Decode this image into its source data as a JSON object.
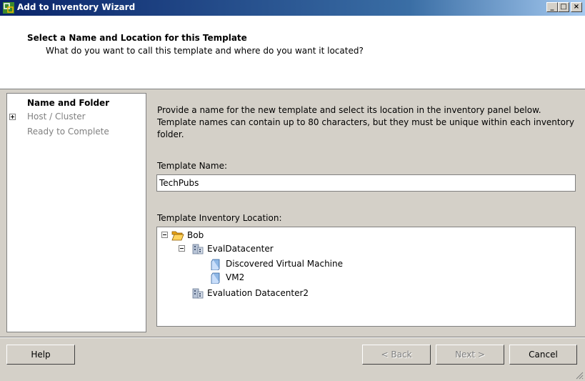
{
  "window": {
    "title": "Add to Inventory Wizard",
    "minimize": "_",
    "maximize": "□",
    "close": "×"
  },
  "header": {
    "title": "Select a Name and Location for this Template",
    "subtitle": "What do you want to call this template and where do you want it located?"
  },
  "steps": [
    {
      "label": "Name and Folder",
      "state": "current"
    },
    {
      "label": "Host / Cluster",
      "state": "pending",
      "expandable": true
    },
    {
      "label": "Ready to Complete",
      "state": "pending"
    }
  ],
  "content": {
    "description": "Provide a name for the new template and select its location in the inventory panel below. Template names can contain up to 80 characters, but they must be unique within each inventory folder.",
    "name_label": "Template Name:",
    "name_value": "TechPubs",
    "location_label": "Template Inventory Location:"
  },
  "tree": [
    {
      "label": "Bob",
      "icon": "folder-open-icon",
      "expanded": true
    },
    {
      "label": "EvalDatacenter",
      "icon": "datacenter-icon",
      "expanded": true
    },
    {
      "label": "Discovered Virtual Machine",
      "icon": "vm-folder-icon"
    },
    {
      "label": "VM2",
      "icon": "vm-folder-icon"
    },
    {
      "label": "Evaluation Datacenter2",
      "icon": "datacenter-icon"
    }
  ],
  "buttons": {
    "help": "Help",
    "back": "< Back",
    "next": "Next >",
    "cancel": "Cancel"
  },
  "colors": {
    "titlebar_start": "#0a246a",
    "titlebar_end": "#a6caf0",
    "dialog_bg": "#d4d0c8",
    "disabled_text": "#808080"
  }
}
